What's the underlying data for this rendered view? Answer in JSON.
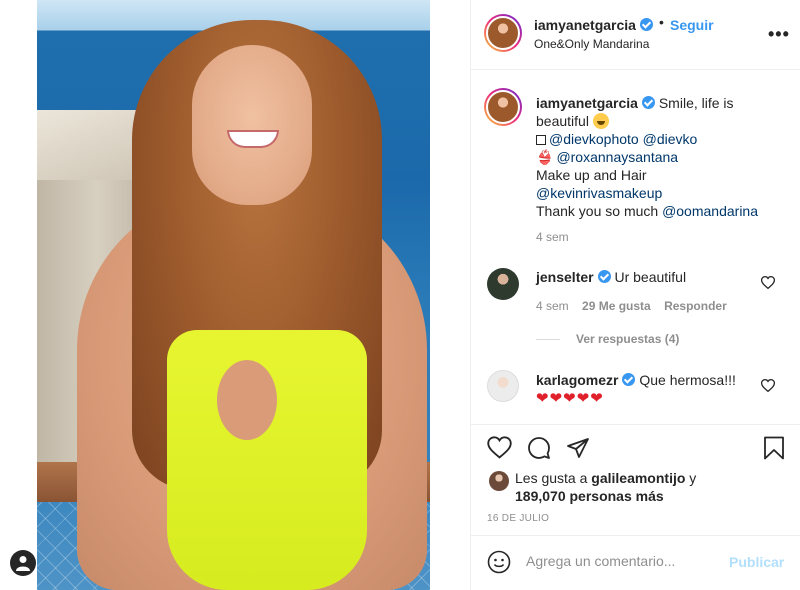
{
  "post": {
    "username": "iamyanetgarcia",
    "follow_label": "Seguir",
    "location": "One&Only Mandarina",
    "more_icon": "more-icon"
  },
  "caption": {
    "username": "iamyanetgarcia",
    "line1": "Smile, life is beautiful",
    "photo_mentions": [
      "@dievkophoto",
      "@dievko"
    ],
    "bikini_mention": "@roxannaysantana",
    "makeup_line": "Make up and Hair",
    "makeup_mention": "@kevinrivasmakeup",
    "thanks_text": "Thank you so much",
    "thanks_mention": "@oomandarina",
    "time": "4 sem"
  },
  "comments": [
    {
      "username": "jenselter",
      "text": "Ur beautiful",
      "time": "4 sem",
      "likes": "29 Me gusta",
      "reply_label": "Responder",
      "view_replies": "Ver respuestas (4)"
    },
    {
      "username": "karlagomezr",
      "text": "Que hermosa!!!",
      "hearts": "❤❤❤❤❤"
    }
  ],
  "likes": {
    "prefix": "Les gusta a",
    "user": "galileamontijo",
    "joiner": "y",
    "others": "189,070 personas más"
  },
  "date": "16 DE JULIO",
  "add_comment": {
    "placeholder": "Agrega un comentario...",
    "publish_label": "Publicar"
  },
  "colors": {
    "accent": "#3897f0",
    "mention": "#00376b",
    "muted": "#8e8e8e",
    "publish_disabled": "#b2dffc"
  }
}
